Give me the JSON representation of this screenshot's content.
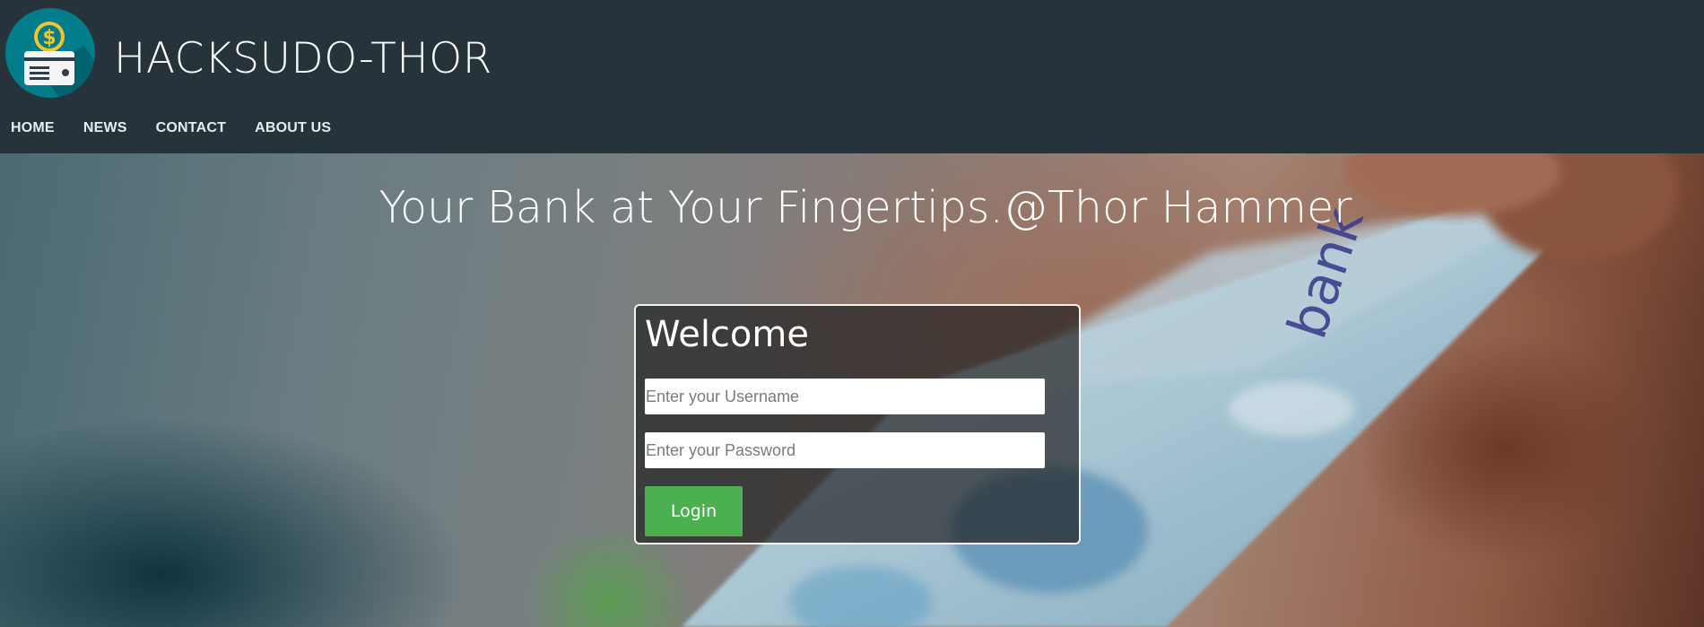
{
  "site": {
    "brand": "HACKSUDO-THOR",
    "logo_icon": "money-card-icon",
    "colors": {
      "header_bg": "#27333a",
      "logo_bg": "#007c8a",
      "logo_coin": "#f4c430",
      "login_button": "#4caf50"
    }
  },
  "nav": {
    "items": [
      {
        "label": "HOME"
      },
      {
        "label": "NEWS"
      },
      {
        "label": "CONTACT"
      },
      {
        "label": "ABOUT US"
      }
    ]
  },
  "hero": {
    "title": "Your Bank at Your Fingertips.@Thor Hammer",
    "card_text": "bank"
  },
  "login": {
    "title": "Welcome",
    "username_placeholder": "Enter your Username",
    "password_placeholder": "Enter your Password",
    "button_label": "Login"
  }
}
